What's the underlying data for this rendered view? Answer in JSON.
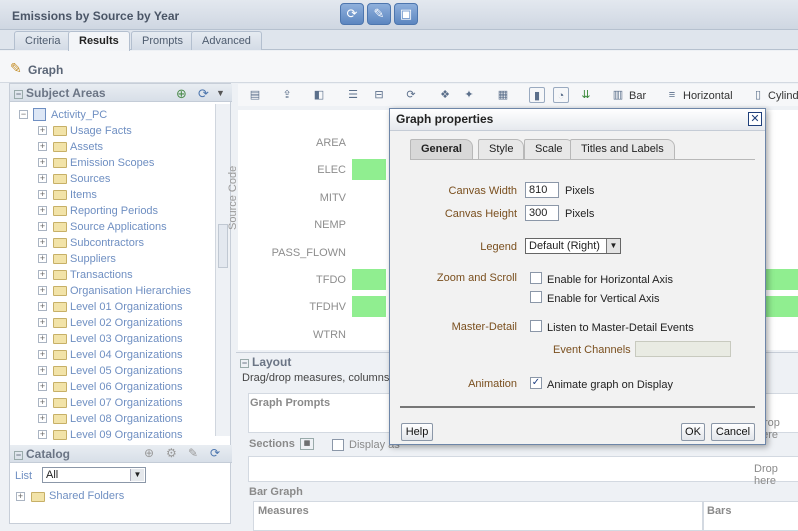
{
  "app": {
    "title": "Emissions by Source by Year"
  },
  "tabs": [
    "Criteria",
    "Results",
    "Prompts",
    "Advanced"
  ],
  "graph": {
    "title": "Graph"
  },
  "toolbar": {
    "bar_label": "Bar",
    "orientation_label": "Horizontal",
    "cylinder_label": "Cylind"
  },
  "subject_areas": {
    "title": "Subject Areas",
    "root": "Activity_PC",
    "items": [
      "Usage Facts",
      "Assets",
      "Emission Scopes",
      "Sources",
      "Items",
      "Reporting Periods",
      "Source Applications",
      "Subcontractors",
      "Suppliers",
      "Transactions",
      "Organisation Hierarchies",
      "Level 01 Organizations",
      "Level 02 Organizations",
      "Level 03 Organizations",
      "Level 04 Organizations",
      "Level 05 Organizations",
      "Level 06 Organizations",
      "Level 07 Organizations",
      "Level 08 Organizations",
      "Level 09 Organizations"
    ]
  },
  "catalog": {
    "title": "Catalog",
    "list_label": "List",
    "list_value": "All",
    "folder": "Shared Folders"
  },
  "chart": {
    "axis_label": "Source Code",
    "categories": [
      "AREA",
      "ELEC",
      "MITV",
      "NEMP",
      "PASS_FLOWN",
      "TFDO",
      "TFDHV",
      "WTRN"
    ]
  },
  "layout": {
    "title": "Layout",
    "hint": "Drag/drop measures, columns",
    "graph_prompts": "Graph Prompts",
    "sections": "Sections",
    "display_as": "Display as",
    "drop_here": "Drop here",
    "bar_graph": "Bar Graph",
    "measures": "Measures",
    "bars": "Bars"
  },
  "dialog": {
    "title": "Graph properties",
    "tabs": [
      "General",
      "Style",
      "Scale",
      "Titles and Labels"
    ],
    "canvas_width_label": "Canvas Width",
    "canvas_width": "810",
    "canvas_height_label": "Canvas Height",
    "canvas_height": "300",
    "pixels": "Pixels",
    "legend_label": "Legend",
    "legend_value": "Default (Right)",
    "zoom_label": "Zoom and Scroll",
    "zoom_h": "Enable for Horizontal Axis",
    "zoom_v": "Enable for Vertical Axis",
    "md_label": "Master-Detail",
    "md_listen": "Listen to Master-Detail Events",
    "event_channels": "Event Channels",
    "animation_label": "Animation",
    "animation_text": "Animate graph on Display",
    "help": "Help",
    "ok": "OK",
    "cancel": "Cancel"
  },
  "colors": {
    "bar": "#90ee90",
    "accent": "#6f8fc2"
  }
}
